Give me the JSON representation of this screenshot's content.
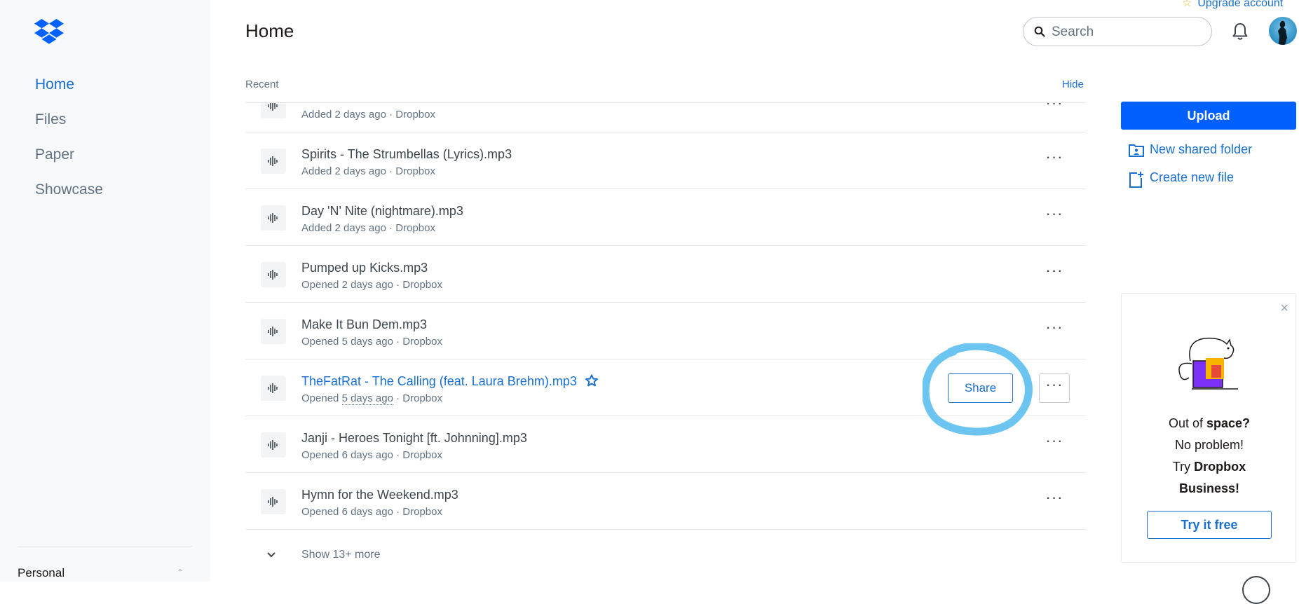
{
  "sidebar": {
    "items": [
      {
        "label": "Home"
      },
      {
        "label": "Files"
      },
      {
        "label": "Paper"
      },
      {
        "label": "Showcase"
      }
    ],
    "account_label": "Personal"
  },
  "header": {
    "title": "Home",
    "upgrade_label": "Upgrade account",
    "search_placeholder": "Search"
  },
  "recent": {
    "label": "Recent",
    "hide_label": "Hide",
    "files": [
      {
        "name": "",
        "meta_action": "Added",
        "meta_time": "2 days ago",
        "meta_location": "Dropbox"
      },
      {
        "name": "Spirits - The Strumbellas (Lyrics).mp3",
        "meta_action": "Added",
        "meta_time": "2 days ago",
        "meta_location": "Dropbox"
      },
      {
        "name": "Day 'N' Nite (nightmare).mp3",
        "meta_action": "Added",
        "meta_time": "2 days ago",
        "meta_location": "Dropbox"
      },
      {
        "name": "Pumped up Kicks.mp3",
        "meta_action": "Opened",
        "meta_time": "2 days ago",
        "meta_location": "Dropbox"
      },
      {
        "name": "Make It Bun Dem.mp3",
        "meta_action": "Opened",
        "meta_time": "5 days ago",
        "meta_location": "Dropbox"
      },
      {
        "name": "TheFatRat - The Calling (feat. Laura Brehm).mp3",
        "meta_action": "Opened",
        "meta_time": "5 days ago",
        "meta_location": "Dropbox"
      },
      {
        "name": "Janji - Heroes Tonight [ft. Johnning].mp3",
        "meta_action": "Opened",
        "meta_time": "6 days ago",
        "meta_location": "Dropbox"
      },
      {
        "name": "Hymn for the Weekend.mp3",
        "meta_action": "Opened",
        "meta_time": "6 days ago",
        "meta_location": "Dropbox"
      }
    ],
    "share_label": "Share",
    "more_label": "···",
    "separator": "·",
    "show_more_label": "Show 13+ more"
  },
  "actions": {
    "upload_label": "Upload",
    "new_shared_folder_label": "New shared folder",
    "create_new_file_label": "Create new file"
  },
  "promo": {
    "line1_a": "Out of ",
    "line1_b": "space?",
    "line2": "No problem!",
    "line3_a": "Try ",
    "line3_b": "Dropbox",
    "line4": "Business!",
    "button_label": "Try it free",
    "close_label": "×"
  },
  "colors": {
    "accent": "#0061fe",
    "link": "#1a6fcf",
    "highlight": "#6cc4f0"
  }
}
